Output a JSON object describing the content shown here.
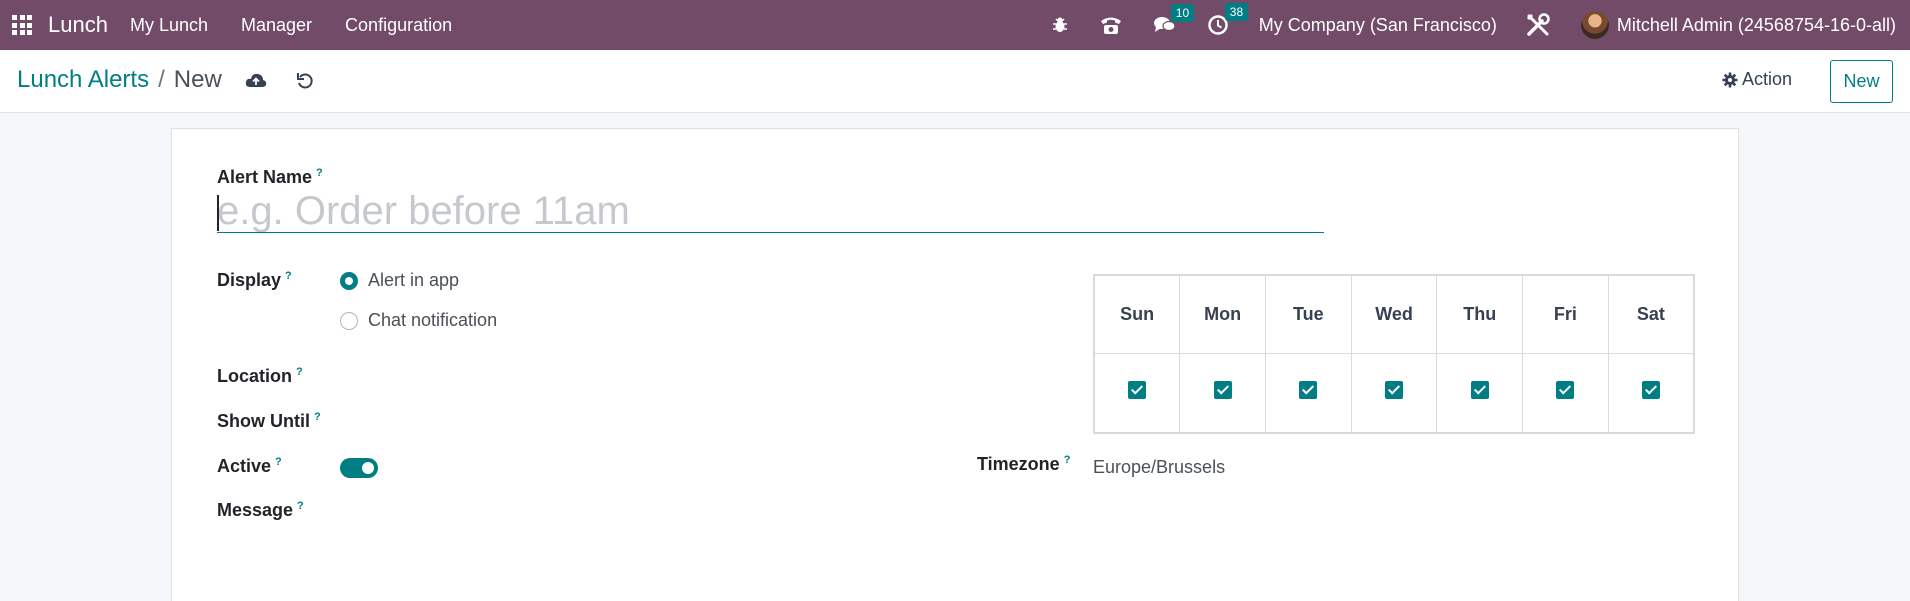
{
  "navbar": {
    "app_name": "Lunch",
    "menus": [
      "My Lunch",
      "Manager",
      "Configuration"
    ],
    "messages_count": "10",
    "activities_count": "38",
    "company": "My Company (San Francisco)",
    "user": "Mitchell Admin (24568754-16-0-all)",
    "icons": [
      "apps-grid-icon",
      "bug-icon",
      "phone-icon",
      "chat-icon",
      "clock-icon",
      "tools-icon"
    ],
    "bg_color": "#714b67"
  },
  "control": {
    "breadcrumb_parent": "Lunch Alerts",
    "breadcrumb_separator": "/",
    "breadcrumb_current": "New",
    "action_label": "Action",
    "new_label": "New"
  },
  "form": {
    "alert_name_label": "Alert Name",
    "alert_name_placeholder": "e.g. Order before 11am",
    "alert_name_value": "",
    "help_mark": "?",
    "display_label": "Display",
    "display_options": [
      {
        "label": "Alert in app",
        "checked": true
      },
      {
        "label": "Chat notification",
        "checked": false
      }
    ],
    "location_label": "Location",
    "show_until_label": "Show Until",
    "active_label": "Active",
    "active_value": true,
    "message_label": "Message",
    "timezone_label": "Timezone",
    "timezone_value": "Europe/Brussels",
    "days": [
      {
        "label": "Sun",
        "checked": true
      },
      {
        "label": "Mon",
        "checked": true
      },
      {
        "label": "Tue",
        "checked": true
      },
      {
        "label": "Wed",
        "checked": true
      },
      {
        "label": "Thu",
        "checked": true
      },
      {
        "label": "Fri",
        "checked": true
      },
      {
        "label": "Sat",
        "checked": true
      }
    ]
  },
  "colors": {
    "accent": "#017e84",
    "brand": "#714b67"
  }
}
